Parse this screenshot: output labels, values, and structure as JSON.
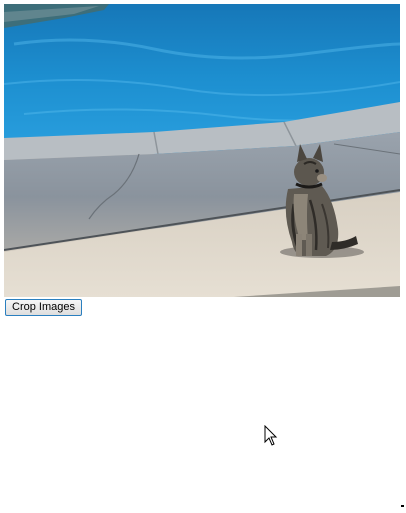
{
  "image": {
    "subject": "cat-sitting-by-pool"
  },
  "toolbar": {
    "crop_label": "Crop Images"
  },
  "colors": {
    "button_border": "#2a7fbf",
    "pool_water": "#1d8fd0",
    "concrete": "#d9d2c6"
  }
}
